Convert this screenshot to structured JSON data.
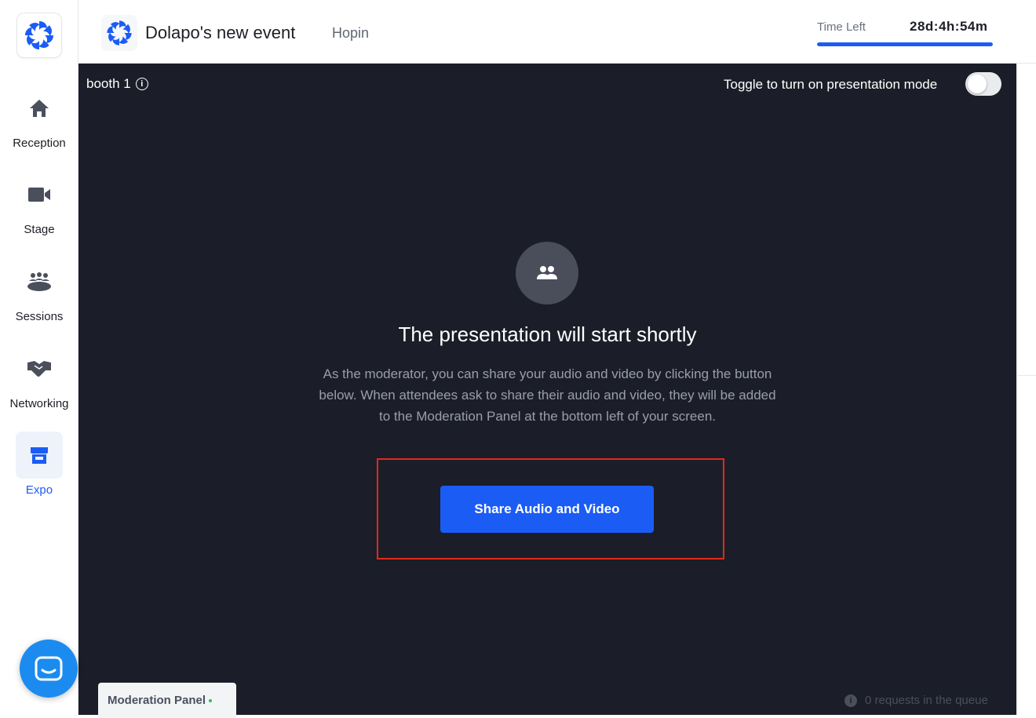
{
  "header": {
    "event_name": "Dolapo's new event",
    "organizer": "Hopin",
    "time_left_label": "Time Left",
    "time_left_value": "28d:4h:54m",
    "time_left_progress": 1.0
  },
  "sidebar": {
    "items": [
      {
        "label": "Reception",
        "icon": "home-icon",
        "active": false
      },
      {
        "label": "Stage",
        "icon": "video-camera-icon",
        "active": false
      },
      {
        "label": "Sessions",
        "icon": "sessions-icon",
        "active": false
      },
      {
        "label": "Networking",
        "icon": "handshake-icon",
        "active": false
      },
      {
        "label": "Expo",
        "icon": "expo-booth-icon",
        "active": true
      }
    ]
  },
  "booth": {
    "name": "booth 1",
    "presentation_toggle_label": "Toggle to turn on presentation mode",
    "presentation_mode": false
  },
  "presentation": {
    "title": "The presentation will start shortly",
    "description": "As the moderator, you can share your audio and video by clicking the button below. When attendees ask to share their audio and video, they will be added to the Moderation Panel at the bottom left of your screen.",
    "share_button": "Share Audio and Video"
  },
  "moderation": {
    "panel_label": "Moderation Panel",
    "queue_text": "0 requests in the queue"
  },
  "colors": {
    "accent": "#1b5cf5",
    "background_dark": "#1b1e28",
    "highlight": "#e02a1c",
    "chat": "#1b8bf0"
  }
}
